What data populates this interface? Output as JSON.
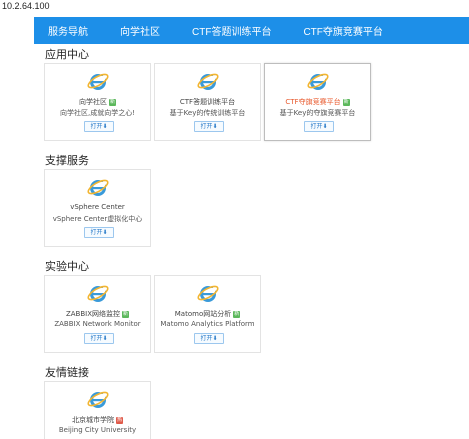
{
  "address": "10.2.64.100",
  "nav": [
    "服务导航",
    "向学社区",
    "CTF答题训练平台",
    "CTF夺旗竞赛平台"
  ],
  "sections": {
    "apps": "应用中心",
    "support": "支撑服务",
    "lab": "实验中心",
    "links": "友情链接"
  },
  "cards": {
    "community": {
      "name": "向学社区",
      "desc": "向学社区,成就向学之心!",
      "tag": "新",
      "open": "打开⬇"
    },
    "ctf_train": {
      "name": "CTF答题训练平台",
      "desc": "基于Key的传统训练平台",
      "open": "打开⬇"
    },
    "ctf_comp": {
      "name": "CTF夺旗竞赛平台",
      "desc": "基于Key的夺旗竞赛平台",
      "tag": "新",
      "open": "打开⬇"
    },
    "vsphere": {
      "name": "vSphere Center",
      "desc": "vSphere Center虚拟化中心",
      "open": "打开⬇"
    },
    "zabbix": {
      "name": "ZABBIX网络监控",
      "desc": "ZABBIX Network Monitor",
      "tag": "新",
      "open": "打开⬇"
    },
    "matomo": {
      "name": "Matomo网站分析",
      "desc": "Matomo Analytics Platform",
      "tag": "新",
      "open": "打开⬇"
    },
    "bcu": {
      "name": "北京城市学院",
      "desc": "Beijing City University",
      "tag": "热",
      "open": "打开⬇"
    }
  },
  "colors": {
    "nav_bg": "#1d8fe8",
    "accent_red": "#e8572a",
    "tag_green": "#5cb85c",
    "tag_red": "#e05b4b"
  },
  "icons": {
    "card_icon": "internet-explorer-icon"
  }
}
